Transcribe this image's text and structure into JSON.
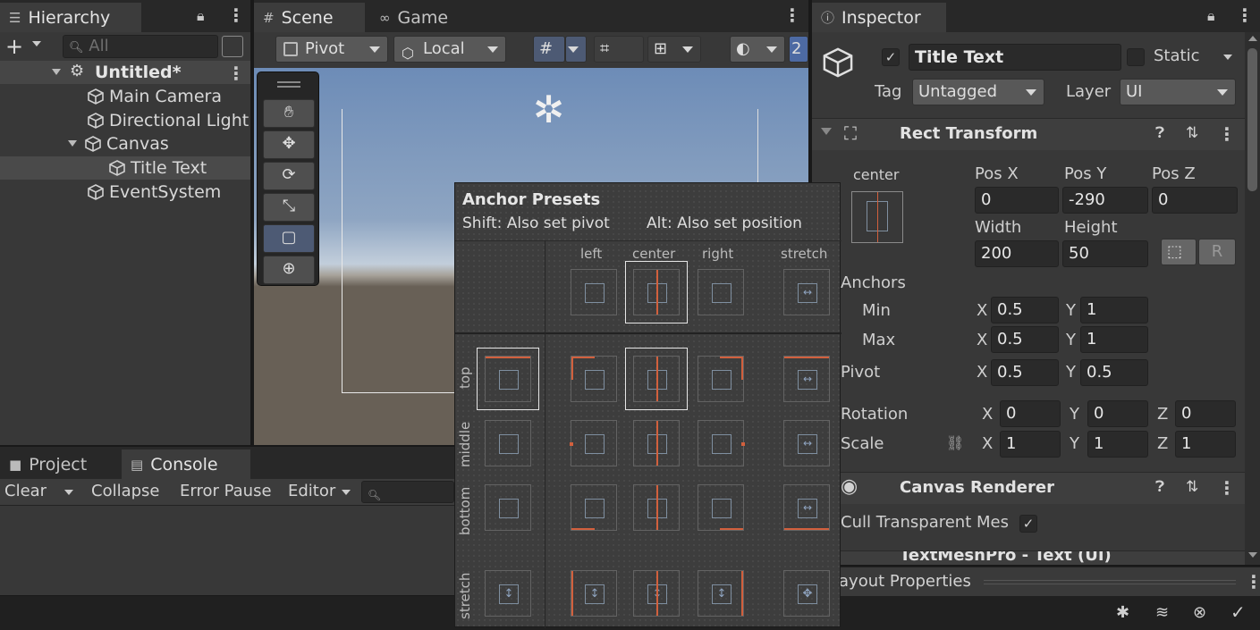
{
  "hierarchy": {
    "tab_label": "Hierarchy",
    "search_placeholder": "All",
    "scene_name": "Untitled*",
    "items": [
      {
        "label": "Main Camera"
      },
      {
        "label": "Directional Light"
      },
      {
        "label": "Canvas"
      },
      {
        "label": "Title Text"
      },
      {
        "label": "EventSystem"
      }
    ]
  },
  "scene_view": {
    "tabs": [
      "Scene",
      "Game"
    ],
    "pivot_label": "Pivot",
    "local_label": "Local",
    "overflow_text": "2"
  },
  "bottom_panel": {
    "tabs": [
      "Project",
      "Console"
    ],
    "toolbar": [
      "Clear",
      "Collapse",
      "Error Pause",
      "Editor"
    ]
  },
  "anchor_presets": {
    "title": "Anchor Presets",
    "hint_pivot": "Shift: Also set pivot",
    "hint_position": "Alt: Also set position",
    "columns": [
      "left",
      "center",
      "right",
      "stretch"
    ],
    "rows": [
      "top",
      "middle",
      "bottom",
      "stretch"
    ]
  },
  "inspector": {
    "tab_label": "Inspector",
    "object_name": "Title Text",
    "static_label": "Static",
    "tag_label": "Tag",
    "tag_value": "Untagged",
    "layer_label": "Layer",
    "layer_value": "UI",
    "rect_transform": {
      "title": "Rect Transform",
      "anchor_mode": "center",
      "pos_x_label": "Pos X",
      "pos_x": "0",
      "pos_y_label": "Pos Y",
      "pos_y": "-290",
      "pos_z_label": "Pos Z",
      "pos_z": "0",
      "width_label": "Width",
      "width": "200",
      "height_label": "Height",
      "height": "50",
      "r_button": "R",
      "anchors_label": "Anchors",
      "min_label": "Min",
      "min_x": "0.5",
      "min_y": "1",
      "max_label": "Max",
      "max_x": "0.5",
      "max_y": "1",
      "pivot_label": "Pivot",
      "pivot_x": "0.5",
      "pivot_y": "0.5",
      "rotation_label": "Rotation",
      "rot_x": "0",
      "rot_y": "0",
      "rot_z": "0",
      "scale_label": "Scale",
      "scale_x": "1",
      "scale_y": "1",
      "scale_z": "1",
      "x": "X",
      "y": "Y",
      "z": "Z"
    },
    "canvas_renderer": {
      "title": "Canvas Renderer",
      "cull_label": "Cull Transparent Mes"
    },
    "textmeshpro_title": "TextMeshPro - Text (UI)",
    "layout_properties": "Layout Properties"
  },
  "colors": {
    "accent": "#d2603d",
    "selection": "#4d5a74",
    "sky": "#6d8cb7",
    "ground": "#686056"
  }
}
